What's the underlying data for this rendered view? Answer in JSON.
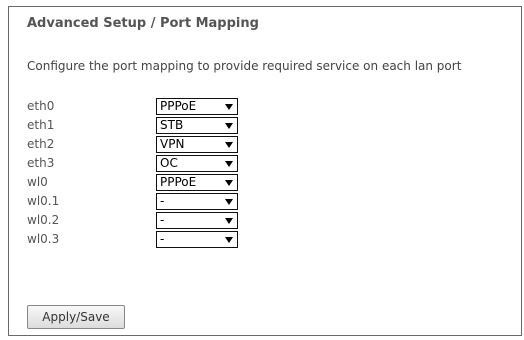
{
  "page": {
    "title": "Advanced Setup / Port Mapping",
    "description": "Configure the port mapping to provide required service on each lan port"
  },
  "ports": [
    {
      "label": "eth0",
      "value": "PPPoE"
    },
    {
      "label": "eth1",
      "value": "STB"
    },
    {
      "label": "eth2",
      "value": "VPN"
    },
    {
      "label": "eth3",
      "value": "OC"
    },
    {
      "label": "wl0",
      "value": "PPPoE"
    },
    {
      "label": "wl0.1",
      "value": "-"
    },
    {
      "label": "wl0.2",
      "value": "-"
    },
    {
      "label": "wl0.3",
      "value": "-"
    }
  ],
  "actions": {
    "apply_label": "Apply/Save"
  },
  "icons": {
    "select_arrow": "chevron-down-icon"
  }
}
